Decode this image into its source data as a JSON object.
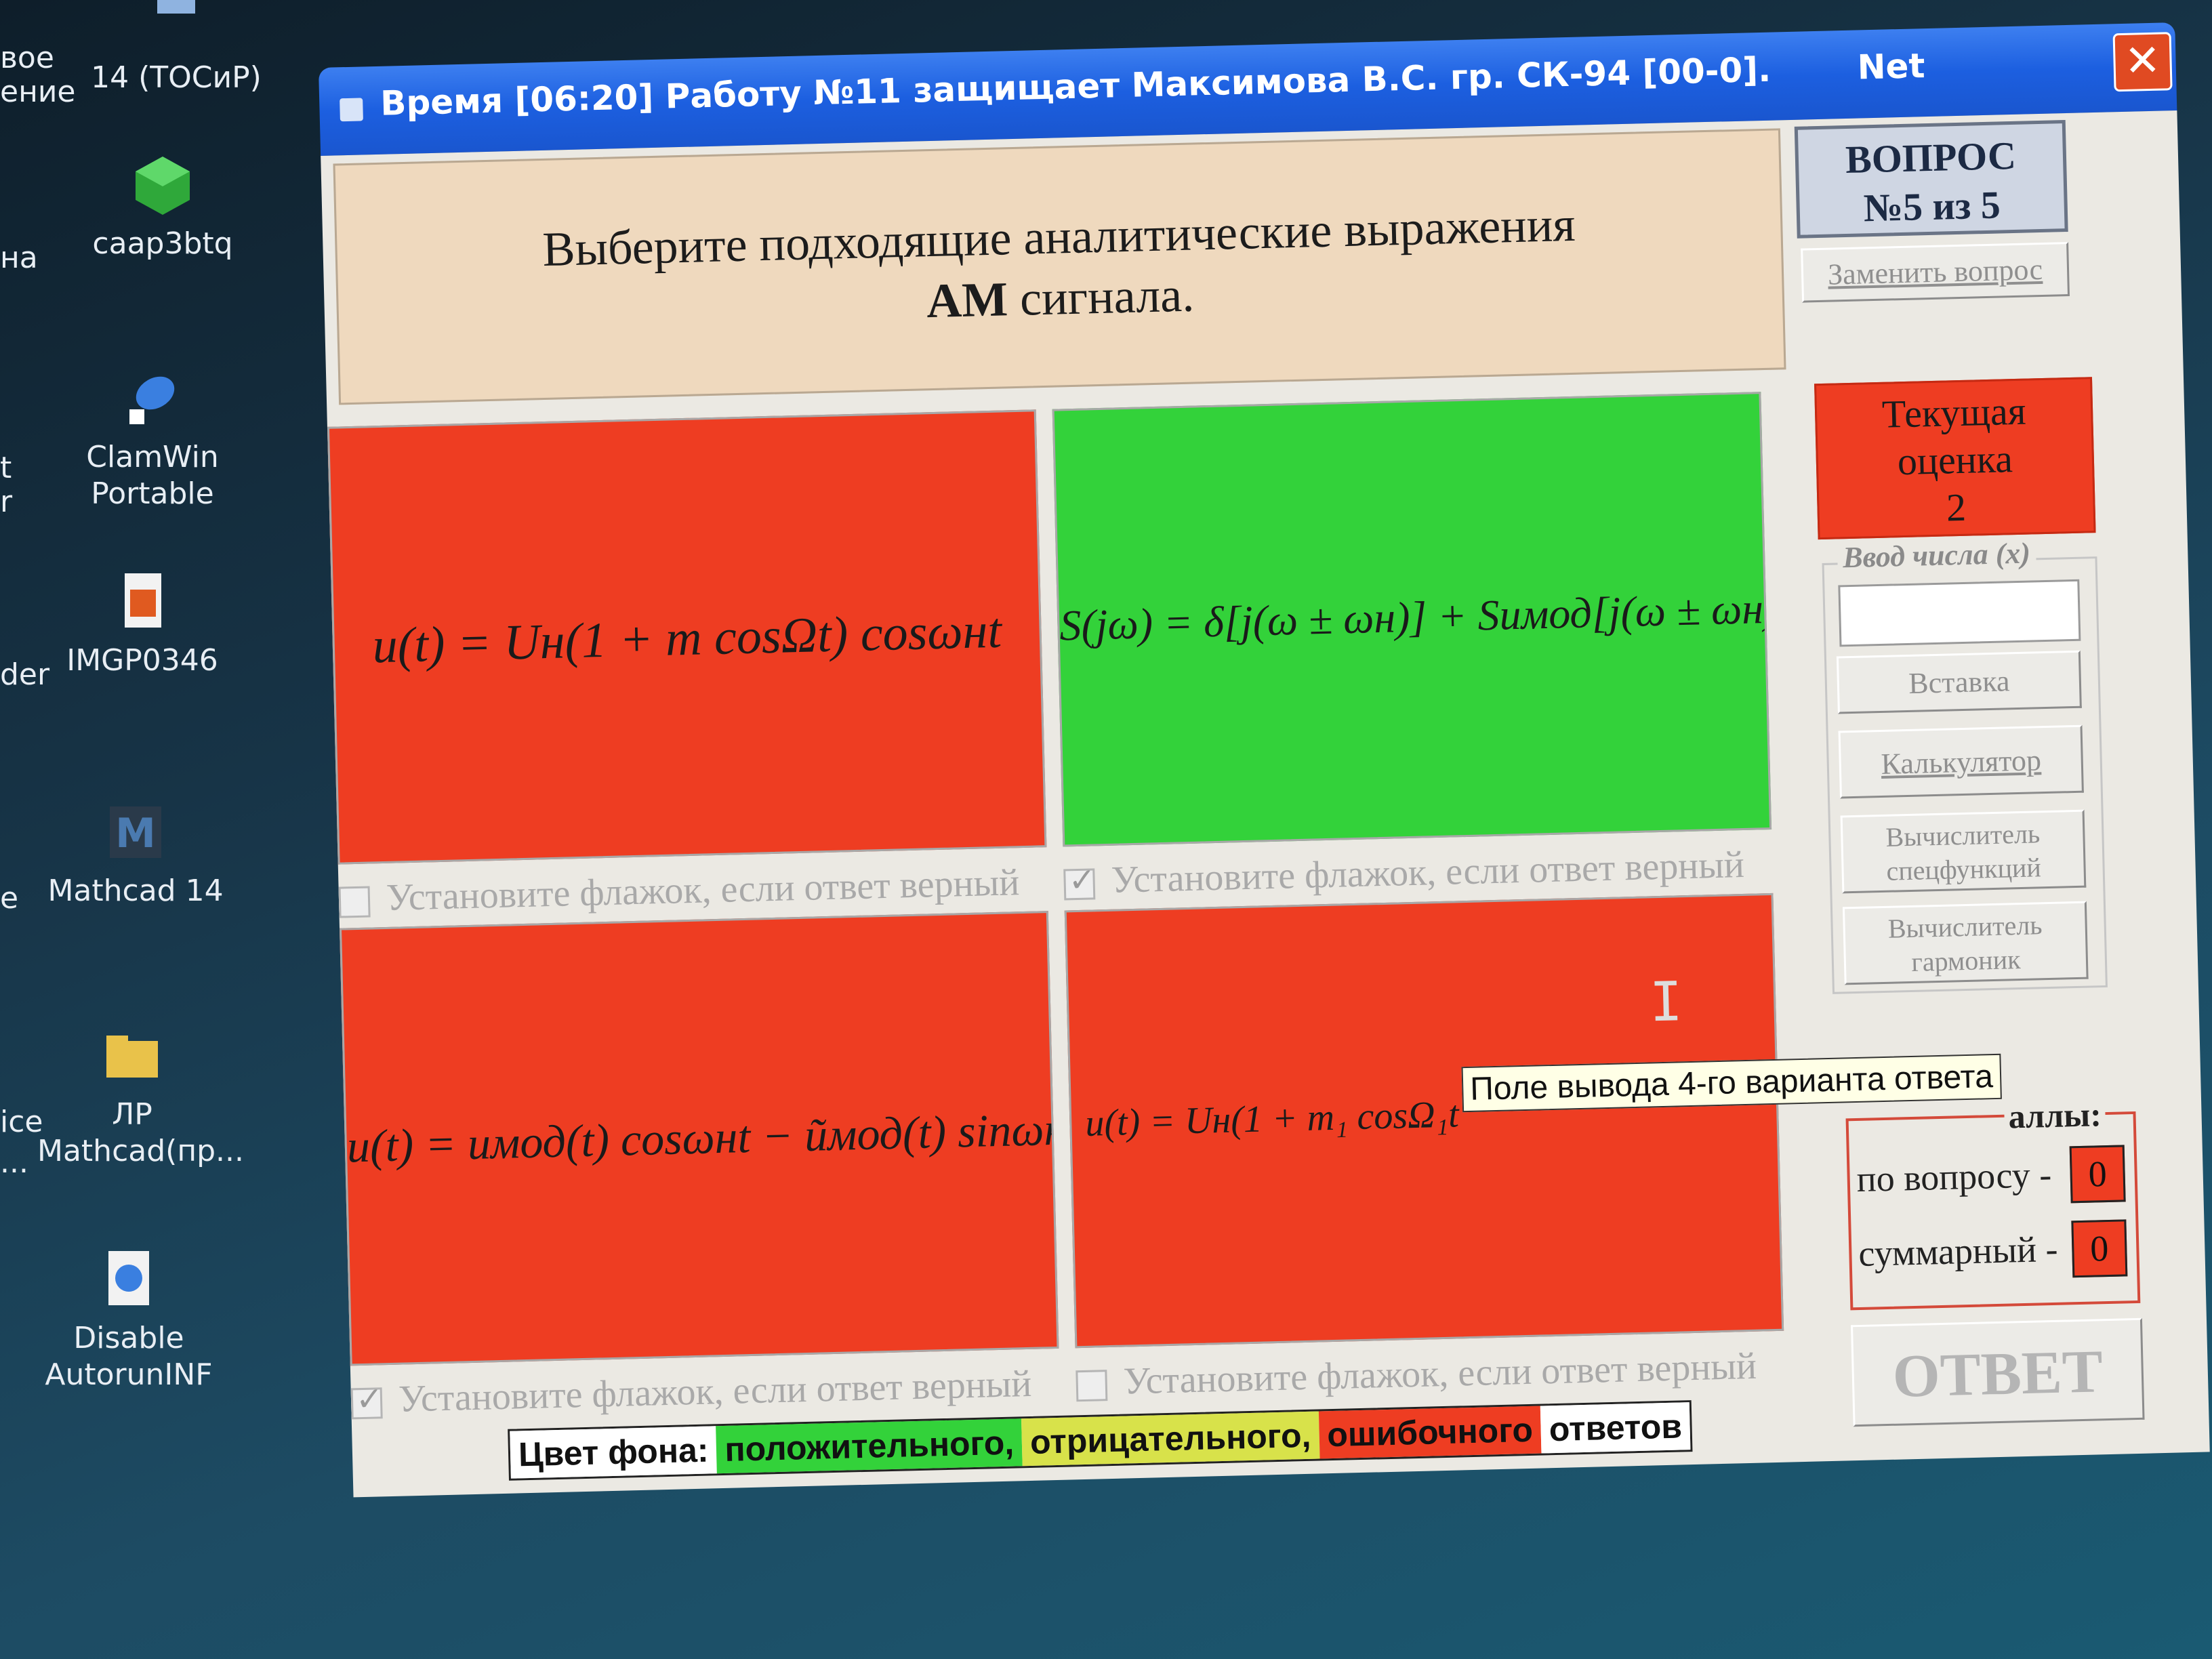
{
  "desktop": {
    "icons": [
      {
        "label": "14 (ТОСиР)",
        "icon": "shortcut-icon"
      },
      {
        "label": "caap3btq",
        "icon": "green-cube-icon"
      },
      {
        "label": "ClamWin Portable",
        "icon": "clamwin-icon"
      },
      {
        "label": "IMGP0346",
        "icon": "image-file-icon"
      },
      {
        "label": "Mathcad 14",
        "icon": "mathcad-icon"
      },
      {
        "label": "ЛР Mathcad(пр...",
        "icon": "folder-icon"
      },
      {
        "label": "Disable AutorunINF",
        "icon": "autorun-file-icon"
      }
    ],
    "edge_labels": [
      "вое",
      "ение",
      "на",
      "t",
      "r",
      "der",
      "e",
      "ice",
      "..."
    ]
  },
  "window": {
    "title": "Время [06:20] Работу №11 защищает Максимова В.С.  гр. СК-94 [00-0].",
    "net_label": "Net",
    "close_glyph": "✕"
  },
  "question": {
    "line1": "Выберите подходящие аналитические выражения",
    "line2_bold": "АМ",
    "line2_rest": " сигнала."
  },
  "answers": [
    {
      "formula": "u(t) = Uн(1 + m cosΩt) cosωнt",
      "color": "#ee3d22",
      "checked": false
    },
    {
      "formula": "S(jω) = δ[j(ω ± ωн)] + Suмод[j(ω ± ωн)]",
      "color": "#33d23a",
      "checked": true
    },
    {
      "formula": "u(t) = uмод(t) cosωнt − ũмод(t) sinωнt",
      "color": "#ee3d22",
      "checked": true
    },
    {
      "formula": "u(t) = Uн(1 + m₁ cosΩ₁t",
      "color": "#ee3d22",
      "checked": false
    }
  ],
  "checkbox_label": "Установите флажок, если ответ верный",
  "tooltip": "Поле вывода 4-го варианта ответа",
  "sidebar": {
    "question_counter_line1": "ВОПРОС",
    "question_counter_line2": "№5 из 5",
    "replace_button": "Заменить вопрос",
    "grade_line1": "Текущая",
    "grade_line2": "оценка",
    "grade_value": "2",
    "input_legend": "Ввод числа (x)",
    "input_value": "",
    "insert_button": "Вставка",
    "calculator_button": "Калькулятор",
    "special_calc_line1": "Вычислитель",
    "special_calc_line2": "спецфункций",
    "harmonics_calc_line1": "Вычислитель",
    "harmonics_calc_line2": "гармоник",
    "score_header": "аллы:",
    "score_question_label": "по вопросу -",
    "score_question_value": "0",
    "score_total_label": "суммарный -",
    "score_total_value": "0",
    "answer_button": "ОТВЕТ"
  },
  "legend": {
    "prefix": "Цвет фона:",
    "positive": "положительного,",
    "negative": "отрицательного,",
    "error": "ошибочного",
    "suffix": "ответов",
    "positive_color": "#33d23a",
    "negative_color": "#d8e24a",
    "error_color": "#ee3d22"
  }
}
